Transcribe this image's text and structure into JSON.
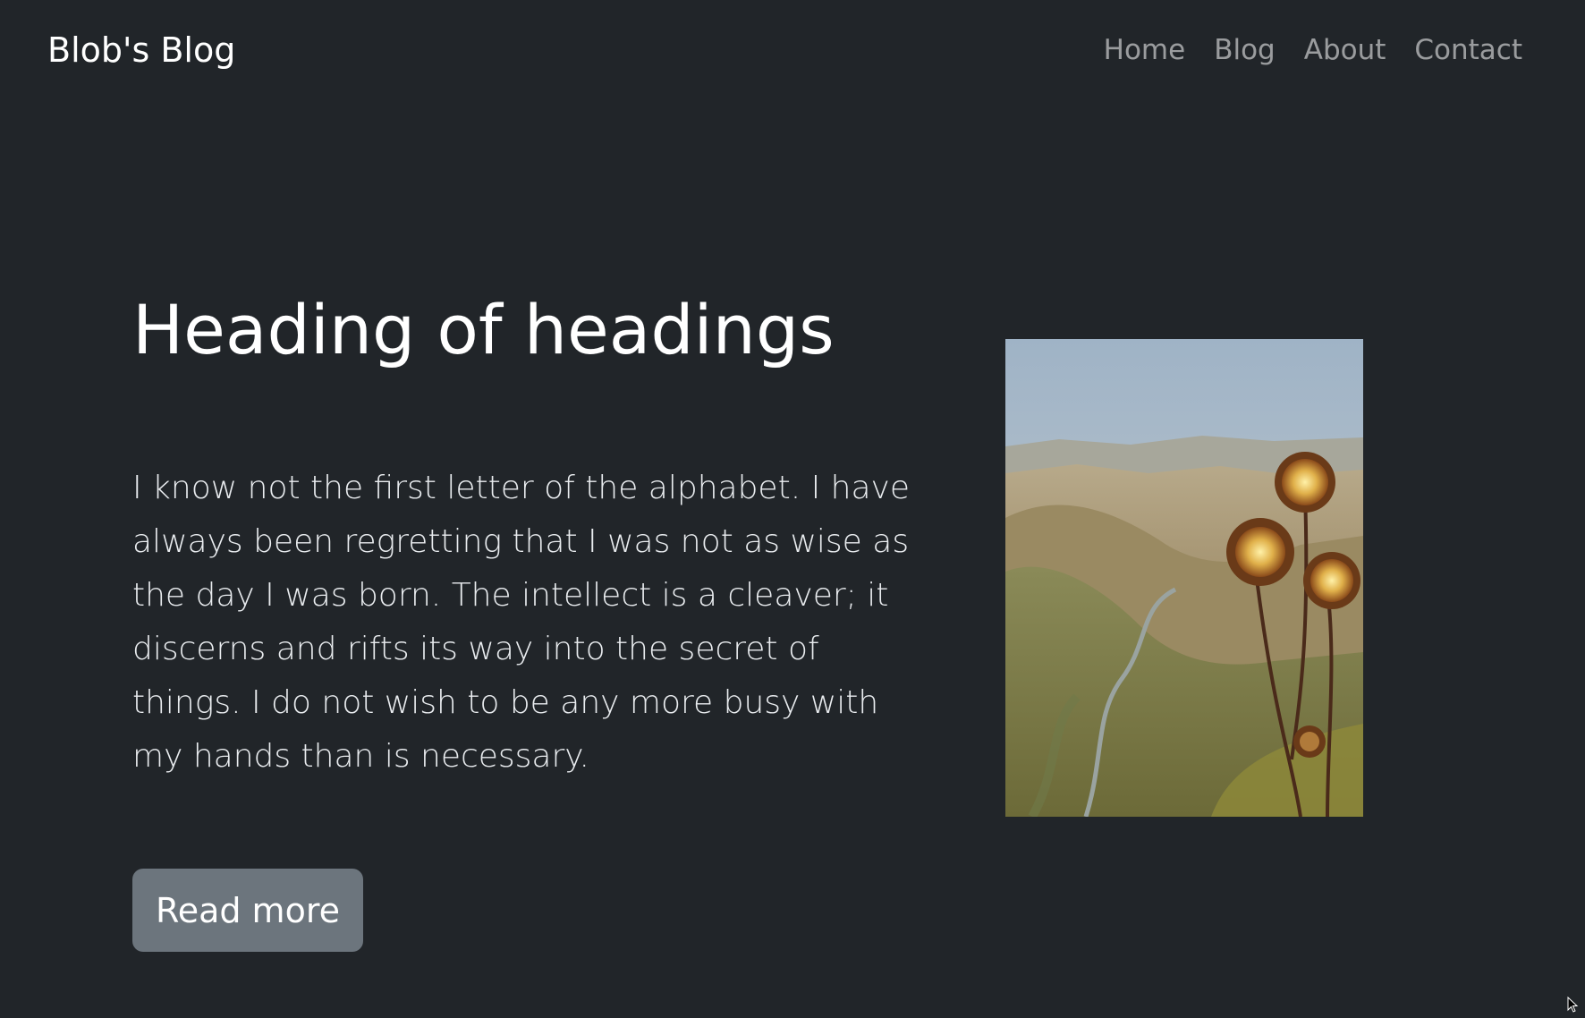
{
  "navbar": {
    "brand": "Blob's Blog",
    "links": [
      "Home",
      "Blog",
      "About",
      "Contact"
    ]
  },
  "hero": {
    "title": "Heading of headings",
    "text": "I know not the first letter of the alphabet. I have always been regretting that I was not as wise as the day I was born. The intellect is a cleaver; it discerns and rifts its way into the secret of things. I do not wish to be any more busy with my hands than is necessary.",
    "button_label": "Read more",
    "image": "landscape-with-thistle-flowers"
  },
  "colors": {
    "background": "#212529",
    "button": "#6c757d",
    "nav_link": "rgba(255,255,255,0.55)"
  }
}
